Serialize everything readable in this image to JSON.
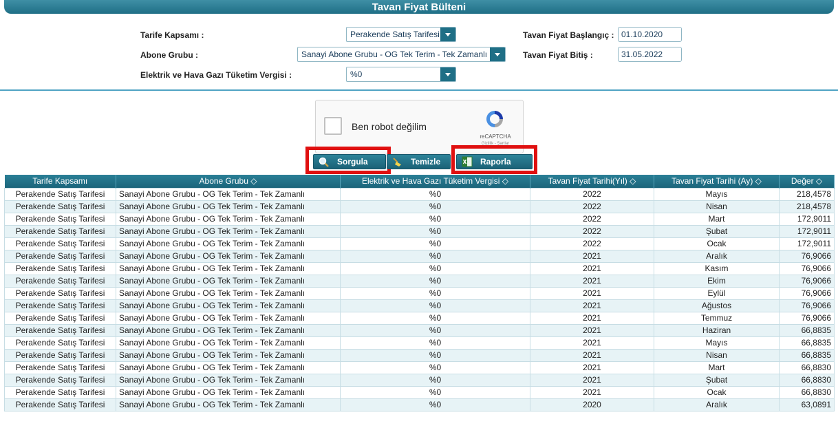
{
  "page": {
    "title": "Tavan Fiyat Bülteni"
  },
  "form": {
    "tarife_label": "Tarife Kapsamı :",
    "tarife_value": "Perakende Satış Tarifesi",
    "abone_label": "Abone Grubu :",
    "abone_value": "Sanayi Abone Grubu - OG Tek Terim - Tek Zamanlı",
    "vergi_label": "Elektrik ve Hava Gazı Tüketim Vergisi :",
    "vergi_value": "%0",
    "baslangic_label": "Tavan Fiyat Başlangıç :",
    "baslangic_value": "01.10.2020",
    "bitis_label": "Tavan Fiyat Bitiş :",
    "bitis_value": "31.05.2022"
  },
  "captcha": {
    "label": "Ben robot değilim",
    "brand": "reCAPTCHA",
    "links": "Gizlilik - Şartlar"
  },
  "buttons": {
    "sorgula": "Sorgula",
    "temizle": "Temizle",
    "raporla": "Raporla"
  },
  "table": {
    "headers": [
      "Tarife Kapsamı",
      "Abone Grubu ◇",
      "Elektrik ve Hava Gazı Tüketim Vergisi ◇",
      "Tavan Fiyat Tarihi(Yıl) ◇",
      "Tavan Fiyat Tarihi (Ay) ◇",
      "Değer ◇"
    ],
    "rows": [
      [
        "Perakende Satış Tarifesi",
        "Sanayi Abone Grubu - OG Tek Terim - Tek Zamanlı",
        "%0",
        "2022",
        "Mayıs",
        "218,4578"
      ],
      [
        "Perakende Satış Tarifesi",
        "Sanayi Abone Grubu - OG Tek Terim - Tek Zamanlı",
        "%0",
        "2022",
        "Nisan",
        "218,4578"
      ],
      [
        "Perakende Satış Tarifesi",
        "Sanayi Abone Grubu - OG Tek Terim - Tek Zamanlı",
        "%0",
        "2022",
        "Mart",
        "172,9011"
      ],
      [
        "Perakende Satış Tarifesi",
        "Sanayi Abone Grubu - OG Tek Terim - Tek Zamanlı",
        "%0",
        "2022",
        "Şubat",
        "172,9011"
      ],
      [
        "Perakende Satış Tarifesi",
        "Sanayi Abone Grubu - OG Tek Terim - Tek Zamanlı",
        "%0",
        "2022",
        "Ocak",
        "172,9011"
      ],
      [
        "Perakende Satış Tarifesi",
        "Sanayi Abone Grubu - OG Tek Terim - Tek Zamanlı",
        "%0",
        "2021",
        "Aralık",
        "76,9066"
      ],
      [
        "Perakende Satış Tarifesi",
        "Sanayi Abone Grubu - OG Tek Terim - Tek Zamanlı",
        "%0",
        "2021",
        "Kasım",
        "76,9066"
      ],
      [
        "Perakende Satış Tarifesi",
        "Sanayi Abone Grubu - OG Tek Terim - Tek Zamanlı",
        "%0",
        "2021",
        "Ekim",
        "76,9066"
      ],
      [
        "Perakende Satış Tarifesi",
        "Sanayi Abone Grubu - OG Tek Terim - Tek Zamanlı",
        "%0",
        "2021",
        "Eylül",
        "76,9066"
      ],
      [
        "Perakende Satış Tarifesi",
        "Sanayi Abone Grubu - OG Tek Terim - Tek Zamanlı",
        "%0",
        "2021",
        "Ağustos",
        "76,9066"
      ],
      [
        "Perakende Satış Tarifesi",
        "Sanayi Abone Grubu - OG Tek Terim - Tek Zamanlı",
        "%0",
        "2021",
        "Temmuz",
        "76,9066"
      ],
      [
        "Perakende Satış Tarifesi",
        "Sanayi Abone Grubu - OG Tek Terim - Tek Zamanlı",
        "%0",
        "2021",
        "Haziran",
        "66,8835"
      ],
      [
        "Perakende Satış Tarifesi",
        "Sanayi Abone Grubu - OG Tek Terim - Tek Zamanlı",
        "%0",
        "2021",
        "Mayıs",
        "66,8835"
      ],
      [
        "Perakende Satış Tarifesi",
        "Sanayi Abone Grubu - OG Tek Terim - Tek Zamanlı",
        "%0",
        "2021",
        "Nisan",
        "66,8835"
      ],
      [
        "Perakende Satış Tarifesi",
        "Sanayi Abone Grubu - OG Tek Terim - Tek Zamanlı",
        "%0",
        "2021",
        "Mart",
        "66,8830"
      ],
      [
        "Perakende Satış Tarifesi",
        "Sanayi Abone Grubu - OG Tek Terim - Tek Zamanlı",
        "%0",
        "2021",
        "Şubat",
        "66,8830"
      ],
      [
        "Perakende Satış Tarifesi",
        "Sanayi Abone Grubu - OG Tek Terim - Tek Zamanlı",
        "%0",
        "2021",
        "Ocak",
        "66,8830"
      ],
      [
        "Perakende Satış Tarifesi",
        "Sanayi Abone Grubu - OG Tek Terim - Tek Zamanlı",
        "%0",
        "2020",
        "Aralık",
        "63,0891"
      ]
    ]
  }
}
